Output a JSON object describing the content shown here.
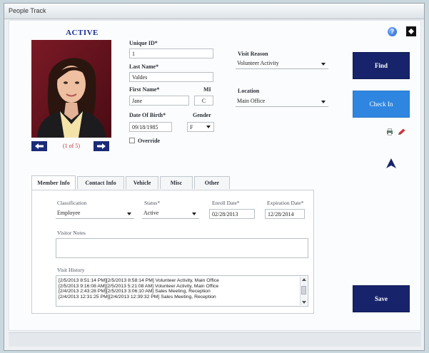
{
  "window": {
    "title": "People Track"
  },
  "header": {
    "status": "ACTIVE"
  },
  "photo": {
    "nav_label": "(1 of 5)"
  },
  "form": {
    "unique_id_label": "Unique ID*",
    "unique_id_value": "1",
    "last_name_label": "Last Name*",
    "last_name_value": "Valdes",
    "first_name_label": "First Name*",
    "first_name_value": "Jane",
    "mi_label": "MI",
    "mi_value": "C",
    "dob_label": "Date Of Birth*",
    "dob_value": "09/18/1985",
    "gender_label": "Gender",
    "gender_value": "F",
    "override_label": "Override",
    "visit_reason_label": "Visit Reason",
    "visit_reason_value": "Volunteer Activity",
    "location_label": "Location",
    "location_value": "Main Office"
  },
  "buttons": {
    "find": "Find",
    "check_in": "Check In",
    "save": "Save"
  },
  "tabs": [
    {
      "label": "Member Info"
    },
    {
      "label": "Contact Info"
    },
    {
      "label": "Vehicle"
    },
    {
      "label": "Misc"
    },
    {
      "label": "Other"
    }
  ],
  "member_info": {
    "classification_label": "Classification",
    "classification_value": "Employee",
    "status_label": "Status*",
    "status_value": "Active",
    "enroll_label": "Enroll Date*",
    "enroll_value": "02/28/2013",
    "expiration_label": "Expiration Date*",
    "expiration_value": "12/28/2014",
    "visitor_notes_label": "Visitor Notes",
    "visit_history_label": "Visit History",
    "visit_history": [
      "[2/5/2013 8:51:14 PM][2/5/2013 8:58:14 PM] Volunteer Activity, Main Office",
      "[2/5/2013 9:16:08 AM][2/5/2013 5:21:08 AM] Volunteer Activity, Main Office",
      "[2/4/2013 2:43:28 PM][2/5/2013 3:06:10 AM] Sales Meeting, Reception",
      "[2/4/2013 12:31:25 PM][2/4/2013 12:39:32 PM] Sales Meeting, Reception"
    ]
  },
  "colors": {
    "accent": "#17246b",
    "checkin": "#2e86e0",
    "status": "#1a2e9c"
  }
}
